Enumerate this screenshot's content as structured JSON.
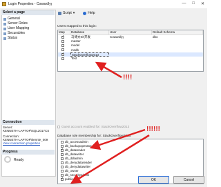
{
  "window": {
    "title": "Login Properties - Cowardlyı̱"
  },
  "left_pane": {
    "header": "Select a page",
    "pages": [
      {
        "label": "General"
      },
      {
        "label": "Server Roles"
      },
      {
        "label": "User Mapping"
      },
      {
        "label": "Securables"
      },
      {
        "label": "Status"
      }
    ],
    "connection_header": "Connection",
    "server_label": "Server:",
    "server_value": "KENNETH-LAPTOP\\SQL2017CS",
    "connection_label": "Connection:",
    "connection_value": "KENNETH-LAPTOP\\kennie_009",
    "view_link": "View connection properties",
    "progress_header": "Progress",
    "progress_status": "Ready"
  },
  "toolbar": {
    "script_label": "Script",
    "help_label": "Help"
  },
  "users_mapped_label": "Users mapped to this login:",
  "mapping_grid": {
    "columns": [
      "Map",
      "Database",
      "User",
      "Default Schema"
    ],
    "rows": [
      {
        "map": true,
        "database": "马博文Sh开发",
        "user": "Cowardlyı̱",
        "schema": "dbo"
      },
      {
        "map": false,
        "database": "master",
        "user": "",
        "schema": ""
      },
      {
        "map": false,
        "database": "model",
        "user": "",
        "schema": ""
      },
      {
        "map": false,
        "database": "msdb",
        "user": "",
        "schema": ""
      },
      {
        "map": true,
        "database": "StackOverflow2013",
        "user": "",
        "schema": ""
      },
      {
        "map": false,
        "database": "Test",
        "user": "",
        "schema": ""
      }
    ]
  },
  "guest_label": "Guest account enabled for: StackOverflow2013",
  "role_membership_label": "Database role membership for: StackOverflow2013",
  "roles": [
    {
      "name": "db_accessadmin",
      "checked": false
    },
    {
      "name": "db_backupoperator",
      "checked": false
    },
    {
      "name": "db_datareader",
      "checked": true
    },
    {
      "name": "db_datawriter",
      "checked": false
    },
    {
      "name": "db_ddladmin",
      "checked": false
    },
    {
      "name": "db_denydatareader",
      "checked": false
    },
    {
      "name": "db_denydatawriter",
      "checked": false
    },
    {
      "name": "db_owner",
      "checked": false
    },
    {
      "name": "db_securityadmin",
      "checked": false
    },
    {
      "name": "public",
      "checked": true
    }
  ],
  "annotations": {
    "bang1": "!!!!",
    "bang2": "!!!!!!",
    "arrow_color": "#e02020"
  },
  "buttons": {
    "ok": "OK",
    "cancel": "Cancel"
  }
}
